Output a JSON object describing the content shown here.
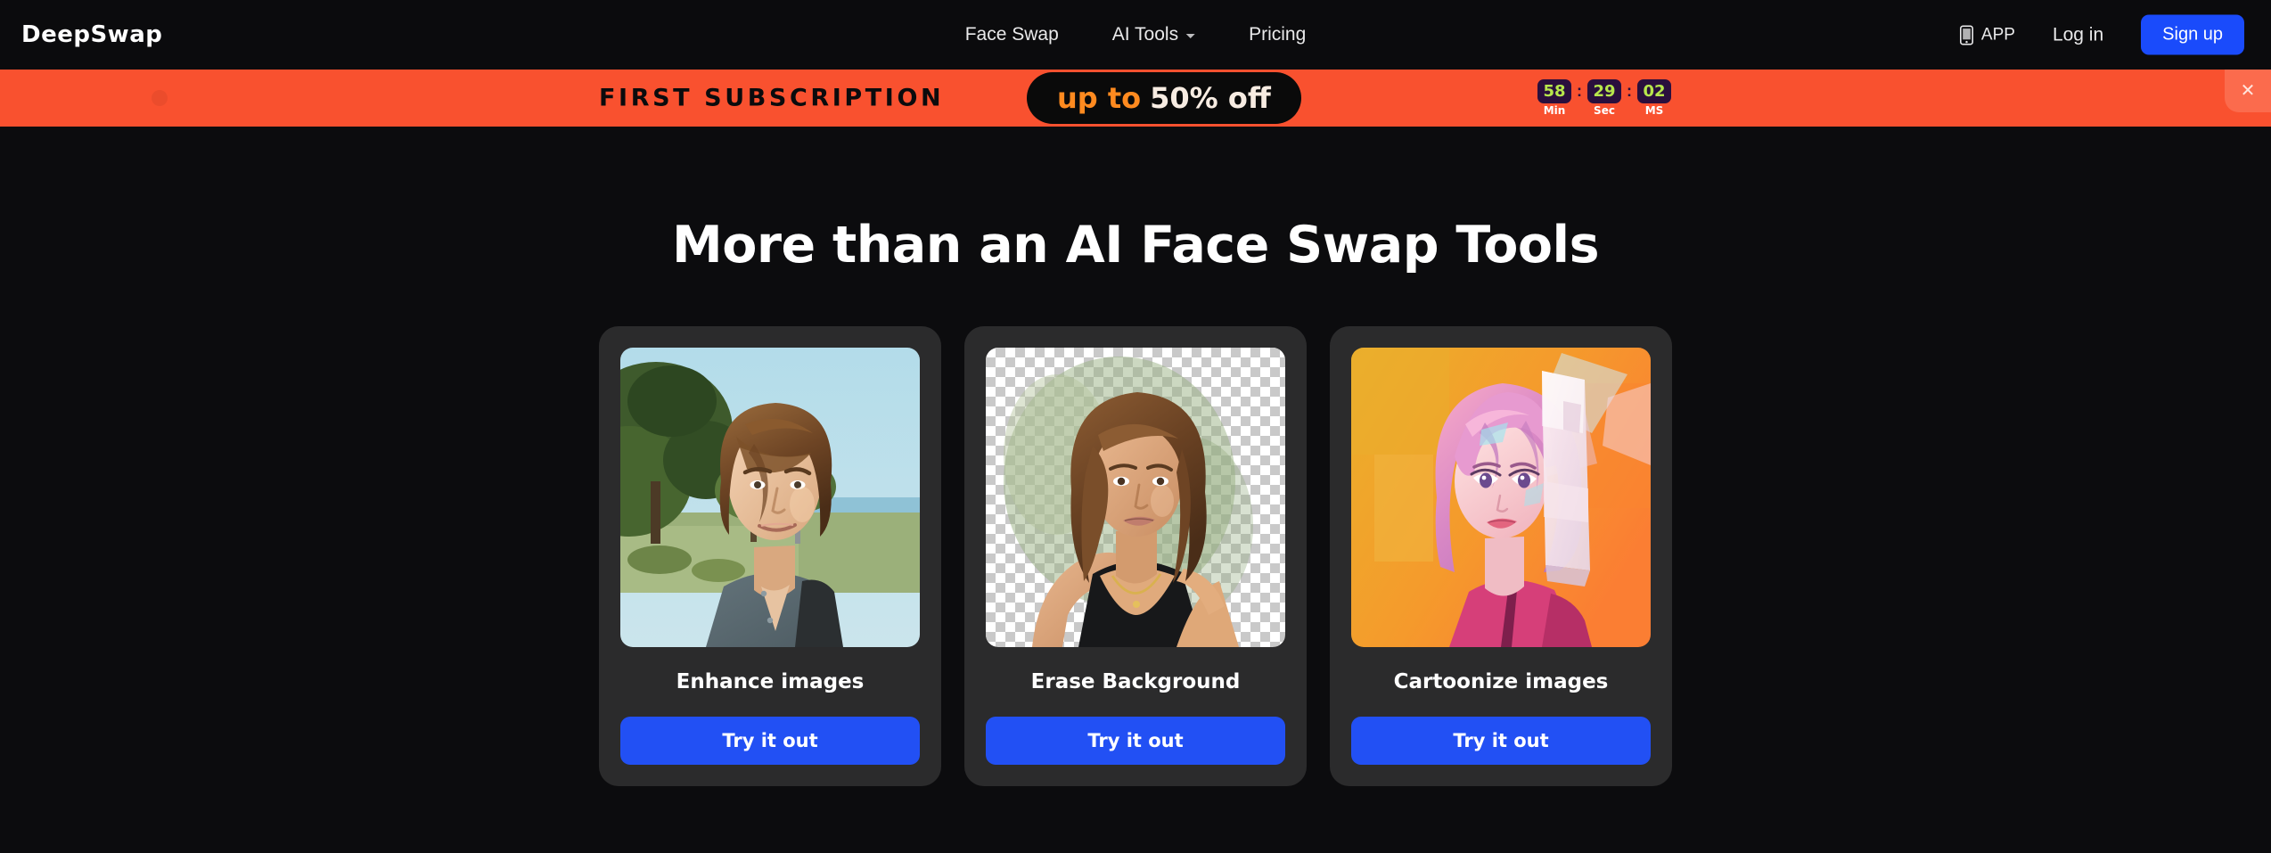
{
  "header": {
    "logo": "DeepSwap",
    "nav": [
      {
        "label": "Face Swap",
        "has_dropdown": false
      },
      {
        "label": "AI Tools",
        "has_dropdown": true
      },
      {
        "label": "Pricing",
        "has_dropdown": false
      }
    ],
    "app_label": "APP",
    "login_label": "Log in",
    "signup_label": "Sign up",
    "signup_color": "#1a4bfb"
  },
  "banner": {
    "title": "FIRST SUBSCRIPTION",
    "discount_prefix": "up to",
    "discount_value": "50% off",
    "background_color": "#f9512f",
    "pill_background": "#0a0a0a",
    "pill_prefix_color": "#ff8a1f",
    "countdown": [
      {
        "value": "58",
        "label": "Min"
      },
      {
        "value": "29",
        "label": "Sec"
      },
      {
        "value": "02",
        "label": "MS"
      }
    ],
    "separator": ":",
    "close_label": "✕"
  },
  "main": {
    "title": "More than an AI Face Swap Tools",
    "cards": [
      {
        "title": "Enhance images",
        "button_label": "Try it out",
        "image": "portrait-man-park"
      },
      {
        "title": "Erase Background",
        "button_label": "Try it out",
        "image": "portrait-woman-transparent-background"
      },
      {
        "title": "Cartoonize images",
        "button_label": "Try it out",
        "image": "cartoon-girl-pink-hair"
      }
    ],
    "button_color": "#2250f4",
    "card_background": "#2b2b2c"
  }
}
